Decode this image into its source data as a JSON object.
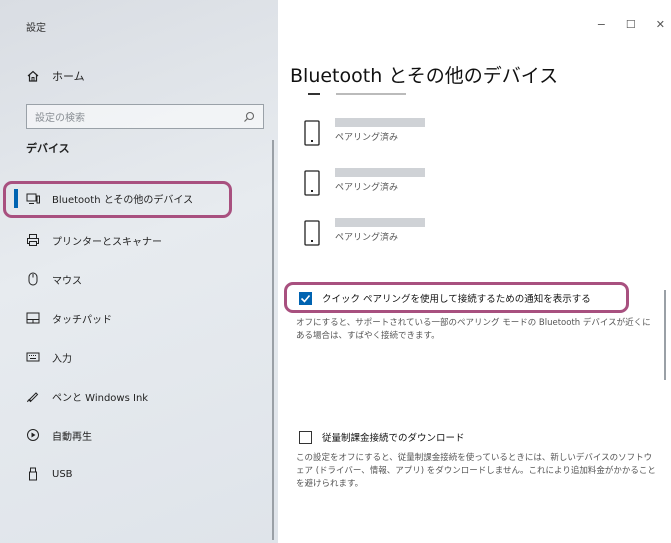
{
  "window": {
    "app_title": "設定",
    "minimize": "−",
    "maximize": "☐",
    "close": "✕"
  },
  "sidebar": {
    "home_label": "ホーム",
    "search_placeholder": "設定の検索",
    "section_title": "デバイス",
    "items": [
      {
        "label": "Bluetooth とその他のデバイス",
        "icon": "bluetooth-devices-icon",
        "active": true
      },
      {
        "label": "プリンターとスキャナー",
        "icon": "printer-icon",
        "active": false
      },
      {
        "label": "マウス",
        "icon": "mouse-icon",
        "active": false
      },
      {
        "label": "タッチパッド",
        "icon": "touchpad-icon",
        "active": false
      },
      {
        "label": "入力",
        "icon": "keyboard-icon",
        "active": false
      },
      {
        "label": "ペンと Windows Ink",
        "icon": "pen-icon",
        "active": false
      },
      {
        "label": "自動再生",
        "icon": "autoplay-icon",
        "active": false
      },
      {
        "label": "USB",
        "icon": "usb-icon",
        "active": false
      }
    ]
  },
  "main": {
    "title": "Bluetooth とその他のデバイス",
    "devices": [
      {
        "status": "ペアリング済み",
        "icon": "phone-icon"
      },
      {
        "status": "ペアリング済み",
        "icon": "phone-icon"
      },
      {
        "status": "ペアリング済み",
        "icon": "phone-icon"
      }
    ],
    "quick_pair": {
      "label": "クイック ペアリングを使用して接続するための通知を表示する",
      "checked": true,
      "description": "オフにすると、サポートされている一部のペアリング モードの Bluetooth デバイスが近くにある場合は、すばやく接続できます。"
    },
    "metered": {
      "label": "従量制課金接続でのダウンロード",
      "checked": false,
      "description": "この設定をオフにすると、従量制課金接続を使っているときには、新しいデバイスのソフトウェア (ドライバー、情報、アプリ) をダウンロードしません。これにより追加料金がかかることを避けられます。"
    }
  },
  "colors": {
    "accent": "#0063b1",
    "highlight": "#a8507f"
  }
}
